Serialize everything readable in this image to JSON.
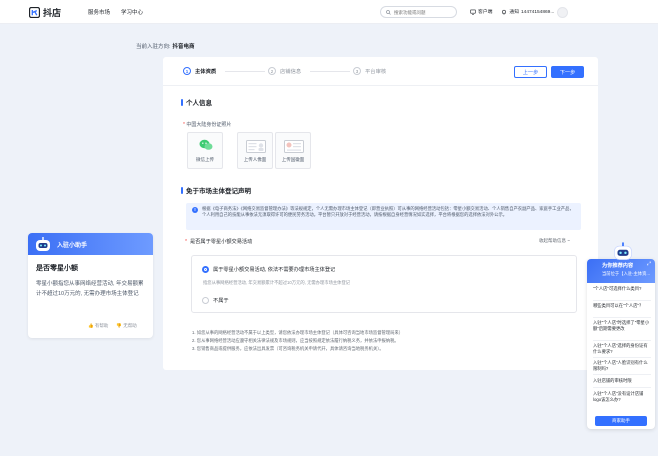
{
  "header": {
    "app_name": "抖店",
    "nav": [
      "服务市场",
      "学习中心"
    ],
    "search_placeholder": "搜索功能或问题",
    "links": [
      "客户端",
      "通知"
    ],
    "account": "14474154869..."
  },
  "direction": {
    "label": "当前入驻方向:",
    "value": "抖音电商"
  },
  "steps": [
    {
      "num": "1",
      "label": "主体资质"
    },
    {
      "num": "2",
      "label": "店铺信息"
    },
    {
      "num": "3",
      "label": "平台审核"
    }
  ],
  "buttons": {
    "prev": "上一步",
    "next": "下一步"
  },
  "personal": {
    "title": "个人信息",
    "id_label": "中国大陆身份证照片",
    "uploads": [
      "微信上传",
      "上传人像面",
      "上传国徽面"
    ]
  },
  "exempt": {
    "title": "免于市场主体登记声明",
    "notice": "根据《电子商务法》《网络交易监督管理办法》等法规规定，个人无需办理市场主体登记（即营业执照）可从事的网络经营活动包括：零星小额交易活动、个人销售自产农副产品、家庭手工业产品，个人利用自己的技能从事依法无须取得许可的便民劳务活动。平台暂只开放对于经营活动，请按根据自身经营情况如实选择，平台将根据您的选择依法对外公示。",
    "question": "是否属于零星小额交易活动",
    "question_right": "收起帮助信息 ~",
    "option_yes": "属于零星小额交易活动, 依法不需要办理市场主体登记",
    "option_yes_desc": "指您从事网络经营活动, 年交易额累计不超过10万元的, 无需办理市场主体登记",
    "option_no": "不属于",
    "footnotes": [
      "1. 如您从事的网络经营活动不属于以上类型，请您依法办理市场主体登记（具体可咨询当地市场监督管理局来）",
      "2. 您从事网络经营活动应遵守相关法律法规及市场规则，应当按照规定依法履行纳税义务，并依法申报纳税。",
      "3. 您销售商品或提供服务，应依法出具发票（可咨询税务机关申请代开，具体请咨询当地税务机关）。"
    ]
  },
  "assistant": {
    "title": "入驻小助手",
    "heading": "是否零星小额",
    "text": "零星小额指您从事网络经营活动, 年交易额累计不超过10万元的, 无需办理市场主体登记",
    "helpful": "有帮助",
    "unhelpful": "无帮助"
  },
  "recommend": {
    "title": "为你推荐内容",
    "subtitle": "当前位于【入驻-主体资...",
    "questions": [
      "\"个人店\"可选择什么类目?",
      "哪些类目可以在\"个人店\"？",
      "入驻\"个人店\"时选择了\"零星小额\"后期需要更改",
      "入驻\"个人店\"选择的身份证有什么要求?",
      "入驻\"个人店\"人脸识别有什么限制吗?",
      "入驻店铺的审核时限",
      "入驻\"个人店\"没有设计店铺logo该怎么办?"
    ],
    "button": "商家助手"
  },
  "colors": {
    "accent": "#3370ff"
  }
}
